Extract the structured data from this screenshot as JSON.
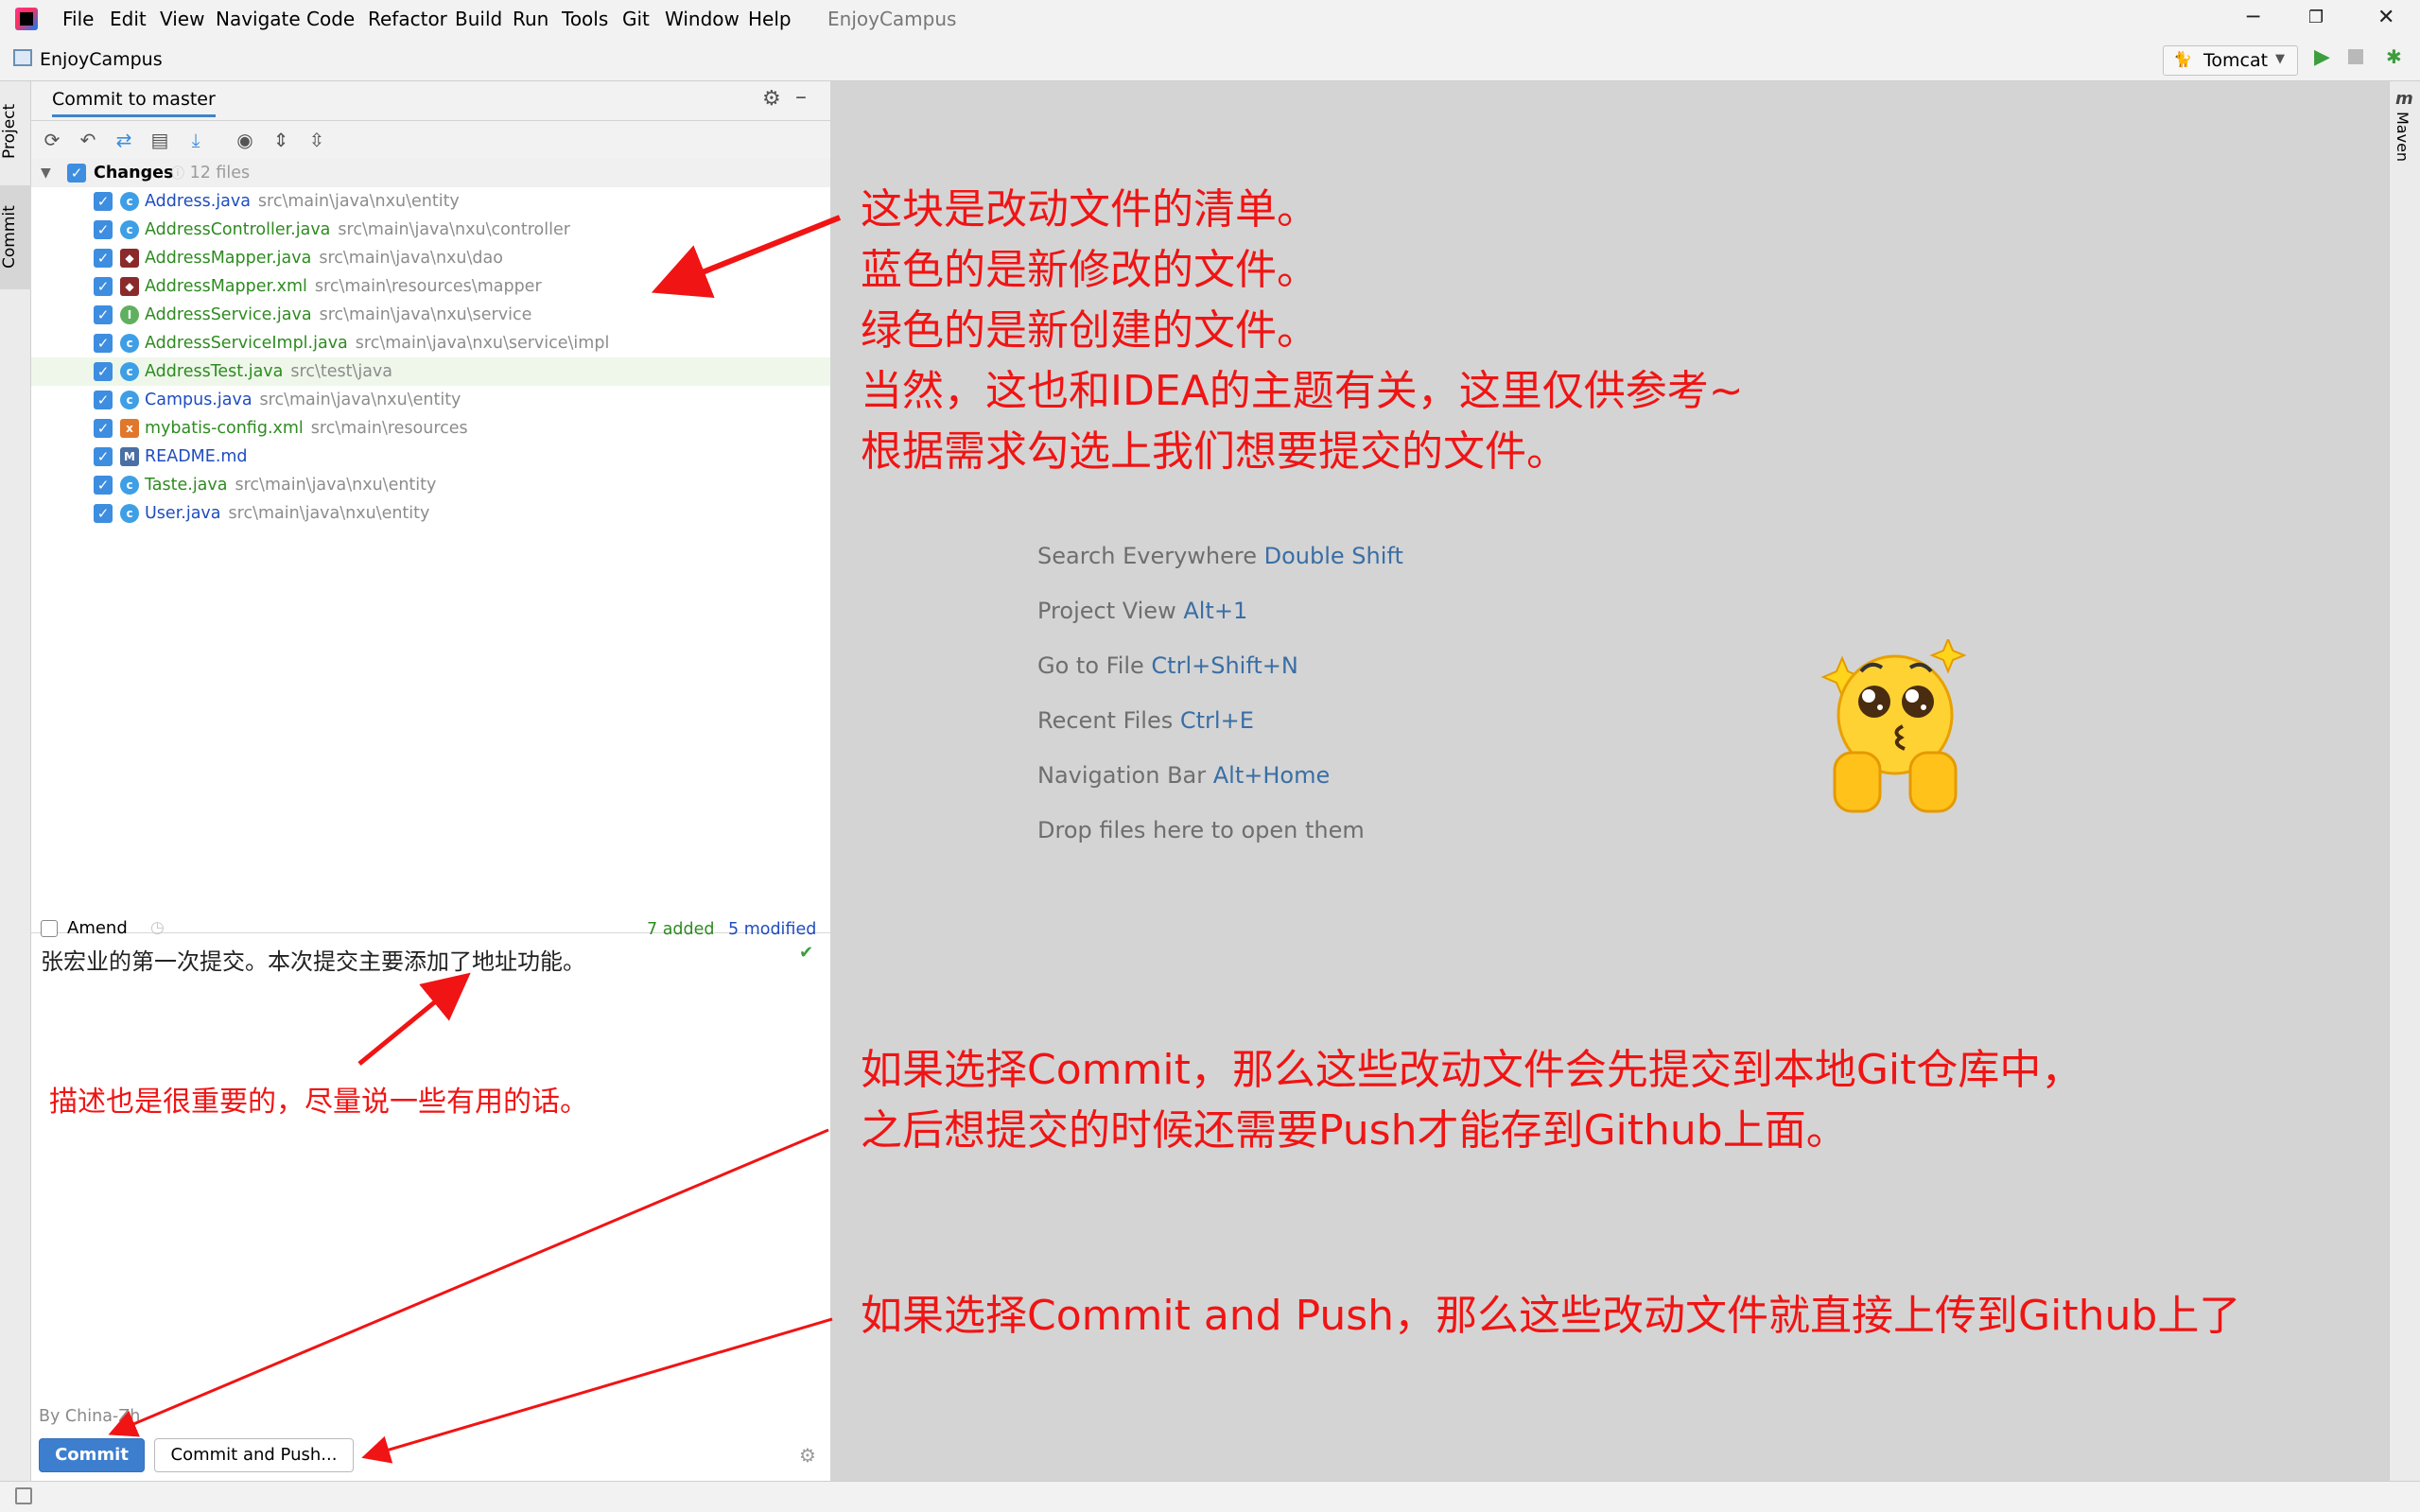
{
  "menubar": {
    "items": [
      "File",
      "Edit",
      "View",
      "Navigate",
      "Code",
      "Refactor",
      "Build",
      "Run",
      "Tools",
      "Git",
      "Window",
      "Help"
    ],
    "title": "EnjoyCampus"
  },
  "navbar": {
    "project": "EnjoyCampus",
    "run_config": "Tomcat"
  },
  "left_strip": {
    "project": "Project",
    "commit": "Commit"
  },
  "right_strip": {
    "maven": "Maven"
  },
  "panel": {
    "tab": "Commit to master",
    "changes_label": "Changes",
    "changes_count": "12 files",
    "files": [
      {
        "name": "Address.java",
        "path": "src\\main\\java\\nxu\\entity",
        "status": "modified",
        "icon": "class-icon"
      },
      {
        "name": "AddressController.java",
        "path": "src\\main\\java\\nxu\\controller",
        "status": "added",
        "icon": "class-icon"
      },
      {
        "name": "AddressMapper.java",
        "path": "src\\main\\java\\nxu\\dao",
        "status": "added",
        "icon": "mapper-icon"
      },
      {
        "name": "AddressMapper.xml",
        "path": "src\\main\\resources\\mapper",
        "status": "added",
        "icon": "mapper-icon"
      },
      {
        "name": "AddressService.java",
        "path": "src\\main\\java\\nxu\\service",
        "status": "added",
        "icon": "interface-icon"
      },
      {
        "name": "AddressServiceImpl.java",
        "path": "src\\main\\java\\nxu\\service\\impl",
        "status": "added",
        "icon": "class-icon"
      },
      {
        "name": "AddressTest.java",
        "path": "src\\test\\java",
        "status": "added",
        "icon": "test-class-icon"
      },
      {
        "name": "Campus.java",
        "path": "src\\main\\java\\nxu\\entity",
        "status": "modified",
        "icon": "class-icon"
      },
      {
        "name": "mybatis-config.xml",
        "path": "src\\main\\resources",
        "status": "added",
        "icon": "xml-icon"
      },
      {
        "name": "README.md",
        "path": "",
        "status": "modified",
        "icon": "markdown-icon"
      },
      {
        "name": "Taste.java",
        "path": "src\\main\\java\\nxu\\entity",
        "status": "added",
        "icon": "class-icon"
      },
      {
        "name": "User.java",
        "path": "src\\main\\java\\nxu\\entity",
        "status": "modified",
        "icon": "class-icon"
      }
    ],
    "amend": "Amend",
    "added": "7 added",
    "modified": "5 modified",
    "message": "张宏业的第一次提交。本次提交主要添加了地址功能。",
    "author": "By China-Zh",
    "commit_button": "Commit",
    "commit_push_button": "Commit and Push..."
  },
  "hints": [
    {
      "text": "Search Everywhere",
      "key": "Double Shift"
    },
    {
      "text": "Project View",
      "key": "Alt+1"
    },
    {
      "text": "Go to File",
      "key": "Ctrl+Shift+N"
    },
    {
      "text": "Recent Files",
      "key": "Ctrl+E"
    },
    {
      "text": "Navigation Bar",
      "key": "Alt+Home"
    },
    {
      "text": "Drop files here to open them",
      "key": ""
    }
  ],
  "annotations": {
    "files_note": [
      "这块是改动文件的清单。",
      "蓝色的是新修改的文件。",
      "绿色的是新创建的文件。",
      "当然，这也和IDEA的主题有关，这里仅供参考~",
      "根据需求勾选上我们想要提交的文件。"
    ],
    "message_note": "描述也是很重要的，尽量说一些有用的话。",
    "commit_note": [
      "如果选择Commit，那么这些改动文件会先提交到本地Git仓库中，",
      "之后想提交的时候还需要Push才能存到Github上面。"
    ],
    "push_note": "如果选择Commit and Push，那么这些改动文件就直接上传到Github上了"
  },
  "colors": {
    "modified": "#1f4dbf",
    "added": "#2e8b20",
    "annotation": "#f01414",
    "primary_button": "#3d7ecf"
  }
}
